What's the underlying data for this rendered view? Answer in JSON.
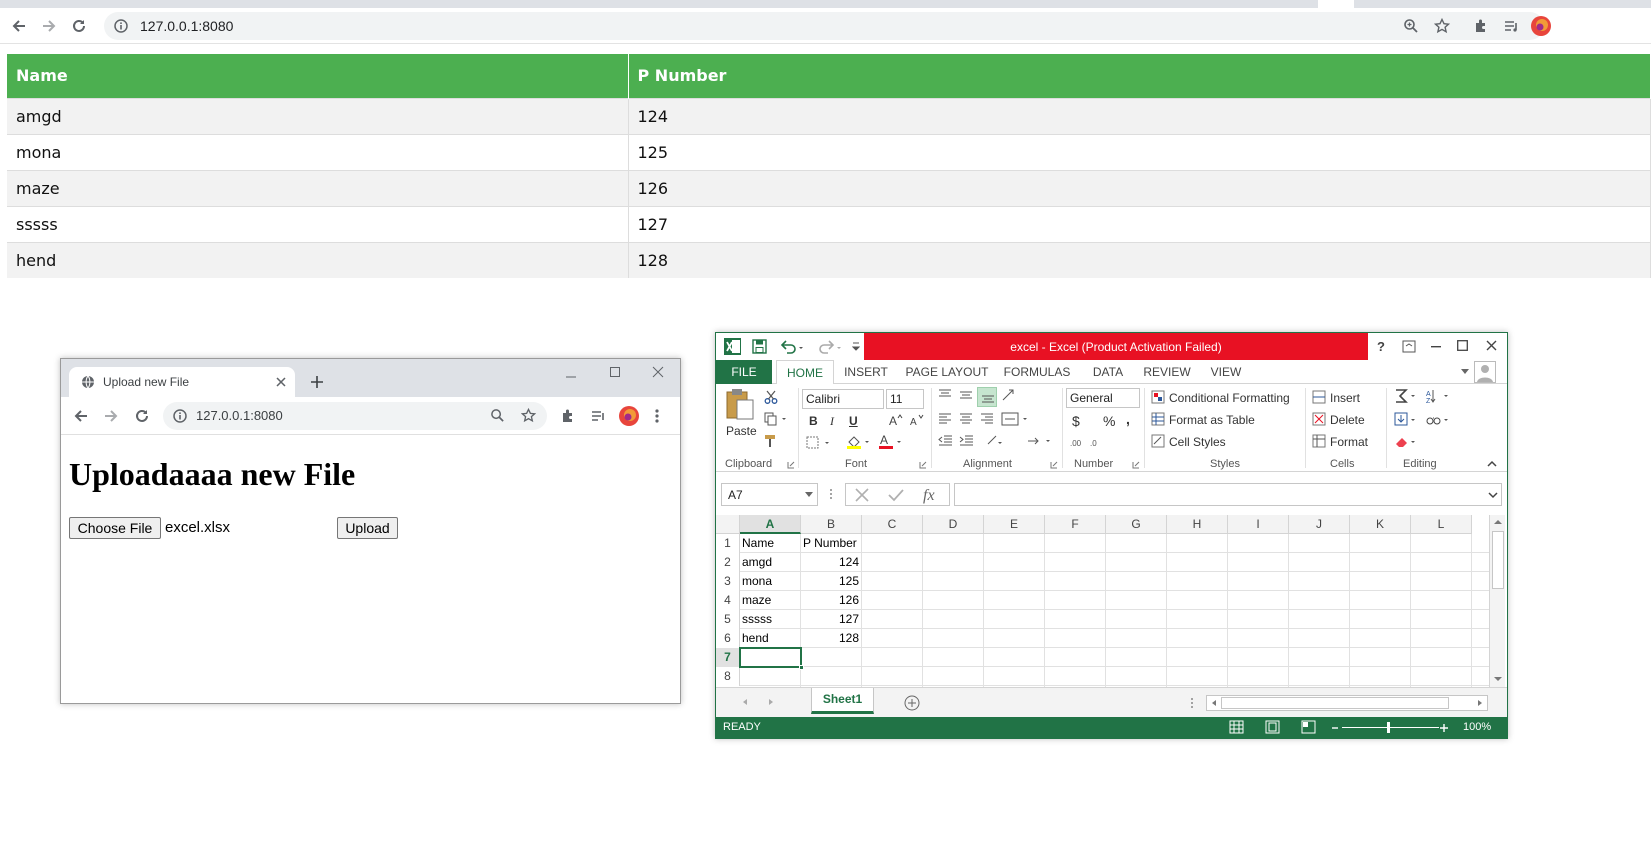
{
  "browser": {
    "url": "127.0.0.1:8080"
  },
  "table": {
    "headers": [
      "Name",
      "P Number"
    ],
    "rows": [
      [
        "amgd",
        "124"
      ],
      [
        "mona",
        "125"
      ],
      [
        "maze",
        "126"
      ],
      [
        "sssss",
        "127"
      ],
      [
        "hend",
        "128"
      ]
    ]
  },
  "upload_window": {
    "tab_title": "Upload new File",
    "url": "127.0.0.1:8080",
    "heading": "Uploadaaaa new File",
    "choose_label": "Choose File",
    "file_name": "excel.xlsx",
    "upload_label": "Upload"
  },
  "excel": {
    "title": "excel -  Excel (Product Activation Failed)",
    "help": "?",
    "ribbon_tabs": [
      "FILE",
      "HOME",
      "INSERT",
      "PAGE LAYOUT",
      "FORMULAS",
      "DATA",
      "REVIEW",
      "VIEW"
    ],
    "active_tab": "HOME",
    "clipboard": {
      "paste": "Paste",
      "label": "Clipboard"
    },
    "font": {
      "name": "Calibri",
      "size": "11",
      "bold": "B",
      "italic": "I",
      "underline": "U",
      "label": "Font"
    },
    "alignment": {
      "label": "Alignment"
    },
    "number": {
      "format": "General",
      "currency": "$",
      "percent": "%",
      "comma": ",",
      "label": "Number"
    },
    "styles": {
      "conditional": "Conditional Formatting",
      "format_table": "Format as Table",
      "cell_styles": "Cell Styles",
      "label": "Styles"
    },
    "cells": {
      "insert": "Insert",
      "delete": "Delete",
      "format": "Format",
      "label": "Cells"
    },
    "editing": {
      "label": "Editing"
    },
    "name_box": "A7",
    "columns": [
      "A",
      "B",
      "C",
      "D",
      "E",
      "F",
      "G",
      "H",
      "I",
      "J",
      "K",
      "L"
    ],
    "row_numbers": [
      "1",
      "2",
      "3",
      "4",
      "5",
      "6",
      "7",
      "8"
    ],
    "cells_data": [
      [
        "Name",
        "P Number"
      ],
      [
        "amgd",
        "124"
      ],
      [
        "mona",
        "125"
      ],
      [
        "maze",
        "126"
      ],
      [
        "sssss",
        "127"
      ],
      [
        "hend",
        "128"
      ]
    ],
    "sheet_tab": "Sheet1",
    "status": "READY",
    "zoom": "100%",
    "accent": "#217346",
    "error_color": "#e81123"
  },
  "colors": {
    "table_header": "#4caf50"
  }
}
